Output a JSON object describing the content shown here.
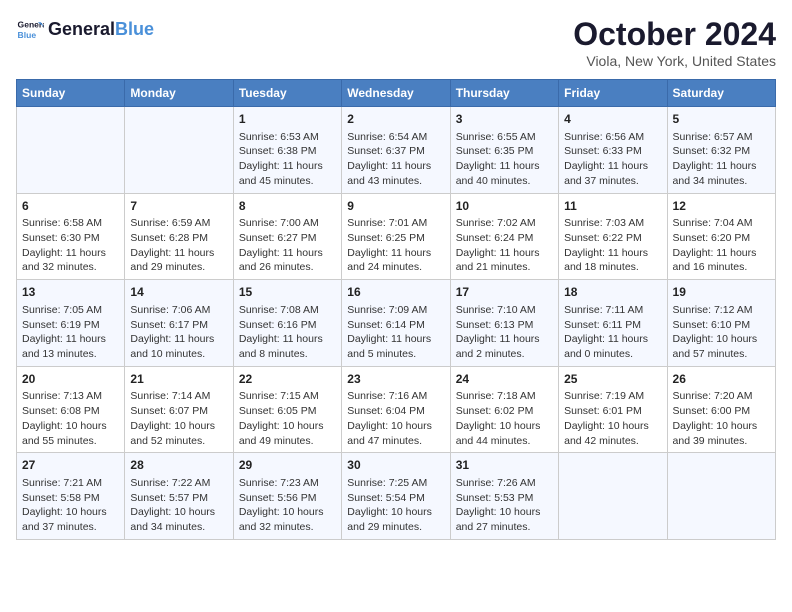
{
  "header": {
    "logo_line1": "General",
    "logo_line2": "Blue",
    "month": "October 2024",
    "location": "Viola, New York, United States"
  },
  "weekdays": [
    "Sunday",
    "Monday",
    "Tuesday",
    "Wednesday",
    "Thursday",
    "Friday",
    "Saturday"
  ],
  "weeks": [
    [
      {
        "day": "",
        "text": ""
      },
      {
        "day": "",
        "text": ""
      },
      {
        "day": "1",
        "text": "Sunrise: 6:53 AM\nSunset: 6:38 PM\nDaylight: 11 hours and 45 minutes."
      },
      {
        "day": "2",
        "text": "Sunrise: 6:54 AM\nSunset: 6:37 PM\nDaylight: 11 hours and 43 minutes."
      },
      {
        "day": "3",
        "text": "Sunrise: 6:55 AM\nSunset: 6:35 PM\nDaylight: 11 hours and 40 minutes."
      },
      {
        "day": "4",
        "text": "Sunrise: 6:56 AM\nSunset: 6:33 PM\nDaylight: 11 hours and 37 minutes."
      },
      {
        "day": "5",
        "text": "Sunrise: 6:57 AM\nSunset: 6:32 PM\nDaylight: 11 hours and 34 minutes."
      }
    ],
    [
      {
        "day": "6",
        "text": "Sunrise: 6:58 AM\nSunset: 6:30 PM\nDaylight: 11 hours and 32 minutes."
      },
      {
        "day": "7",
        "text": "Sunrise: 6:59 AM\nSunset: 6:28 PM\nDaylight: 11 hours and 29 minutes."
      },
      {
        "day": "8",
        "text": "Sunrise: 7:00 AM\nSunset: 6:27 PM\nDaylight: 11 hours and 26 minutes."
      },
      {
        "day": "9",
        "text": "Sunrise: 7:01 AM\nSunset: 6:25 PM\nDaylight: 11 hours and 24 minutes."
      },
      {
        "day": "10",
        "text": "Sunrise: 7:02 AM\nSunset: 6:24 PM\nDaylight: 11 hours and 21 minutes."
      },
      {
        "day": "11",
        "text": "Sunrise: 7:03 AM\nSunset: 6:22 PM\nDaylight: 11 hours and 18 minutes."
      },
      {
        "day": "12",
        "text": "Sunrise: 7:04 AM\nSunset: 6:20 PM\nDaylight: 11 hours and 16 minutes."
      }
    ],
    [
      {
        "day": "13",
        "text": "Sunrise: 7:05 AM\nSunset: 6:19 PM\nDaylight: 11 hours and 13 minutes."
      },
      {
        "day": "14",
        "text": "Sunrise: 7:06 AM\nSunset: 6:17 PM\nDaylight: 11 hours and 10 minutes."
      },
      {
        "day": "15",
        "text": "Sunrise: 7:08 AM\nSunset: 6:16 PM\nDaylight: 11 hours and 8 minutes."
      },
      {
        "day": "16",
        "text": "Sunrise: 7:09 AM\nSunset: 6:14 PM\nDaylight: 11 hours and 5 minutes."
      },
      {
        "day": "17",
        "text": "Sunrise: 7:10 AM\nSunset: 6:13 PM\nDaylight: 11 hours and 2 minutes."
      },
      {
        "day": "18",
        "text": "Sunrise: 7:11 AM\nSunset: 6:11 PM\nDaylight: 11 hours and 0 minutes."
      },
      {
        "day": "19",
        "text": "Sunrise: 7:12 AM\nSunset: 6:10 PM\nDaylight: 10 hours and 57 minutes."
      }
    ],
    [
      {
        "day": "20",
        "text": "Sunrise: 7:13 AM\nSunset: 6:08 PM\nDaylight: 10 hours and 55 minutes."
      },
      {
        "day": "21",
        "text": "Sunrise: 7:14 AM\nSunset: 6:07 PM\nDaylight: 10 hours and 52 minutes."
      },
      {
        "day": "22",
        "text": "Sunrise: 7:15 AM\nSunset: 6:05 PM\nDaylight: 10 hours and 49 minutes."
      },
      {
        "day": "23",
        "text": "Sunrise: 7:16 AM\nSunset: 6:04 PM\nDaylight: 10 hours and 47 minutes."
      },
      {
        "day": "24",
        "text": "Sunrise: 7:18 AM\nSunset: 6:02 PM\nDaylight: 10 hours and 44 minutes."
      },
      {
        "day": "25",
        "text": "Sunrise: 7:19 AM\nSunset: 6:01 PM\nDaylight: 10 hours and 42 minutes."
      },
      {
        "day": "26",
        "text": "Sunrise: 7:20 AM\nSunset: 6:00 PM\nDaylight: 10 hours and 39 minutes."
      }
    ],
    [
      {
        "day": "27",
        "text": "Sunrise: 7:21 AM\nSunset: 5:58 PM\nDaylight: 10 hours and 37 minutes."
      },
      {
        "day": "28",
        "text": "Sunrise: 7:22 AM\nSunset: 5:57 PM\nDaylight: 10 hours and 34 minutes."
      },
      {
        "day": "29",
        "text": "Sunrise: 7:23 AM\nSunset: 5:56 PM\nDaylight: 10 hours and 32 minutes."
      },
      {
        "day": "30",
        "text": "Sunrise: 7:25 AM\nSunset: 5:54 PM\nDaylight: 10 hours and 29 minutes."
      },
      {
        "day": "31",
        "text": "Sunrise: 7:26 AM\nSunset: 5:53 PM\nDaylight: 10 hours and 27 minutes."
      },
      {
        "day": "",
        "text": ""
      },
      {
        "day": "",
        "text": ""
      }
    ]
  ]
}
